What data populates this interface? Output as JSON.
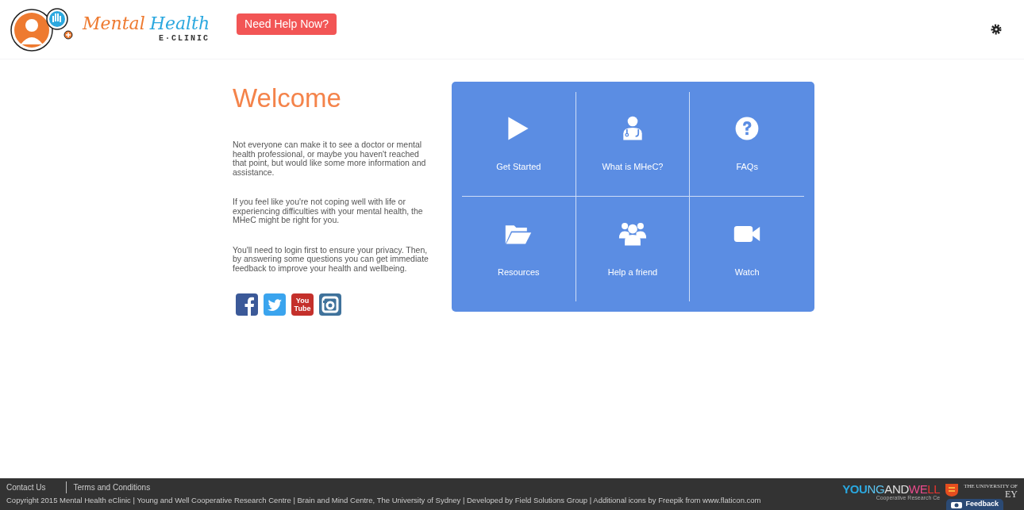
{
  "header": {
    "logo": {
      "word_1": "Mental",
      "word_2": "Health",
      "subtitle": "E·CLINIC"
    },
    "help_button": "Need Help Now?"
  },
  "welcome": {
    "title": "Welcome",
    "paragraphs": [
      "Not everyone can make it to see a doctor or mental health professional, or maybe you haven't reached that point, but would like some more information and assistance.",
      "If you feel like you're not coping well with life or experiencing difficulties with your mental health, the MHeC might be right for you.",
      "You'll need to login first to ensure your privacy. Then, by answering some questions you can get immediate feedback to improve your health and wellbeing."
    ],
    "social": [
      {
        "kind": "facebook"
      },
      {
        "kind": "twitter"
      },
      {
        "kind": "youtube",
        "label": "You Tube"
      },
      {
        "kind": "instagram"
      }
    ]
  },
  "tiles": [
    {
      "kind": "play",
      "label": "Get Started"
    },
    {
      "kind": "doctor",
      "label": "What is MHeC?"
    },
    {
      "kind": "question",
      "label": "FAQs"
    },
    {
      "kind": "folder",
      "label": "Resources"
    },
    {
      "kind": "group",
      "label": "Help a friend"
    },
    {
      "kind": "video",
      "label": "Watch"
    }
  ],
  "footer": {
    "links": [
      "Contact Us",
      "Terms and Conditions"
    ],
    "copyright": "Copyright 2015 Mental Health eClinic | Young and Well Cooperative Research Centre | Brain and Mind Centre, The University of Sydney | Developed by Field Solutions Group | Additional icons by Freepik from www.flaticon.com",
    "partner_logo": {
      "parts": [
        "YOU",
        "NG",
        "AND",
        "WE",
        "LL"
      ],
      "tagline": "Cooperative Research Ce"
    },
    "university": {
      "small": "THE UNIVERSITY OF",
      "large": "EY"
    },
    "feedback": "Feedback"
  }
}
